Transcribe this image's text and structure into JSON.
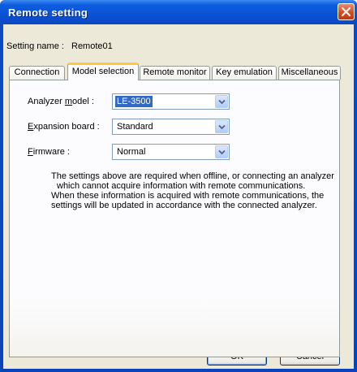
{
  "window": {
    "title": "Remote setting",
    "close_icon": "close-icon"
  },
  "setting": {
    "label": "Setting name :",
    "value": "Remote01"
  },
  "tabs": [
    {
      "label": "Connection",
      "active": false
    },
    {
      "label": "Model selection",
      "active": true
    },
    {
      "label": "Remote monitor",
      "active": false
    },
    {
      "label": "Key emulation",
      "active": false
    },
    {
      "label": "Miscellaneous",
      "active": false
    }
  ],
  "model_selection": {
    "analyzer_model": {
      "label_pre": "Analyzer ",
      "label_mnemonic": "m",
      "label_post": "odel :",
      "value": "LE-3500"
    },
    "expansion_board": {
      "label_pre": "",
      "label_mnemonic": "E",
      "label_post": "xpansion board :",
      "value": "Standard"
    },
    "firmware": {
      "label_pre": "",
      "label_mnemonic": "F",
      "label_post": "irmware :",
      "value": "Normal"
    },
    "info_lines": [
      "The settings above are required when offline, or connecting an analyzer",
      "which cannot acquire information with remote communications.",
      "When these information is acquired with remote communications, the",
      "settings will be updated in accordance with the connected analyzer."
    ]
  },
  "buttons": {
    "ok": "OK",
    "cancel": "Cancel"
  }
}
